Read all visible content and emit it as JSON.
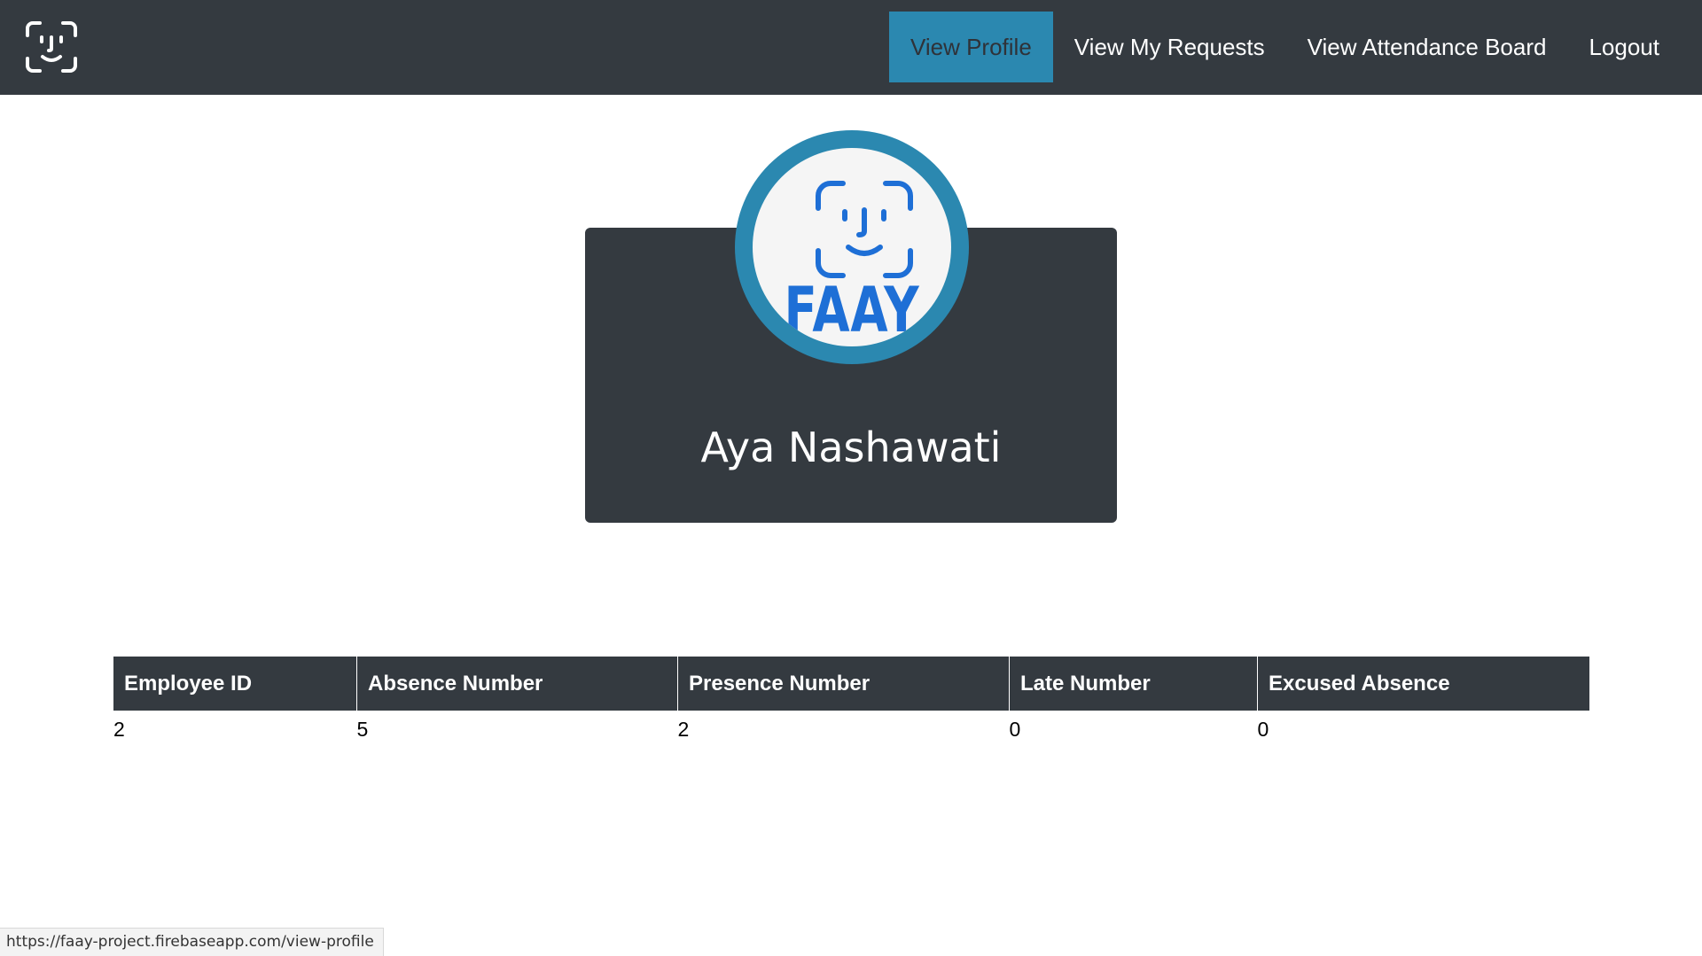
{
  "nav": {
    "brand_icon": "face-id-icon",
    "items": [
      {
        "label": "View Profile",
        "active": true
      },
      {
        "label": "View My Requests",
        "active": false
      },
      {
        "label": "View Attendance Board",
        "active": false
      },
      {
        "label": "Logout",
        "active": false
      }
    ]
  },
  "profile": {
    "logo_icon": "face-id-icon",
    "logo_text": "FAAY",
    "name": "Aya Nashawati"
  },
  "table": {
    "headers": [
      "Employee ID",
      "Absence Number",
      "Presence Number",
      "Late Number",
      "Excused Absence"
    ],
    "rows": [
      [
        "2",
        "5",
        "2",
        "0",
        "0"
      ]
    ]
  },
  "status_bar": {
    "url": "https://faay-project.firebaseapp.com/view-profile"
  },
  "colors": {
    "navbar": "#343a40",
    "accent": "#2b88b0",
    "logo_blue": "#1e6fd6"
  }
}
